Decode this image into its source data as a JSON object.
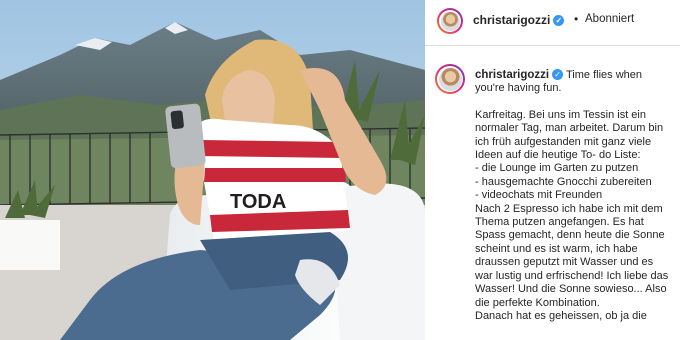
{
  "post": {
    "author": {
      "username": "christarigozzi",
      "verified": true,
      "follow_status": "Abonniert",
      "separator": "•"
    },
    "caption": {
      "lead": "Time flies when you're having fun.",
      "paragraphs": [
        "Karfreitag. Bei uns im Tessin ist ein normaler Tag, man arbeitet. Darum bin ich früh aufgestanden mit ganz viele Ideen auf die heutige To- do Liste:",
        "- die Lounge im Garten zu putzen",
        "- hausgemachte Gnocchi zubereiten",
        "- videochats mit Freunden",
        "Nach 2 Espresso ich habe ich mit dem Thema putzen angefangen. Es hat Spass gemacht, denn heute die Sonne scheint und es ist warm, ich habe draussen geputzt mit Wasser und es war lustig und erfrischend! Ich liebe das Wasser! Und die Sonne sowieso... Also die perfekte Kombination.",
        "Danach hat es geheissen, ob ja die"
      ]
    },
    "image": {
      "shirt_text": "TODA"
    }
  },
  "colors": {
    "verified": "#3897f0",
    "text": "#262626",
    "divider": "#dbdbdb",
    "shirt_red": "#c8283a"
  }
}
